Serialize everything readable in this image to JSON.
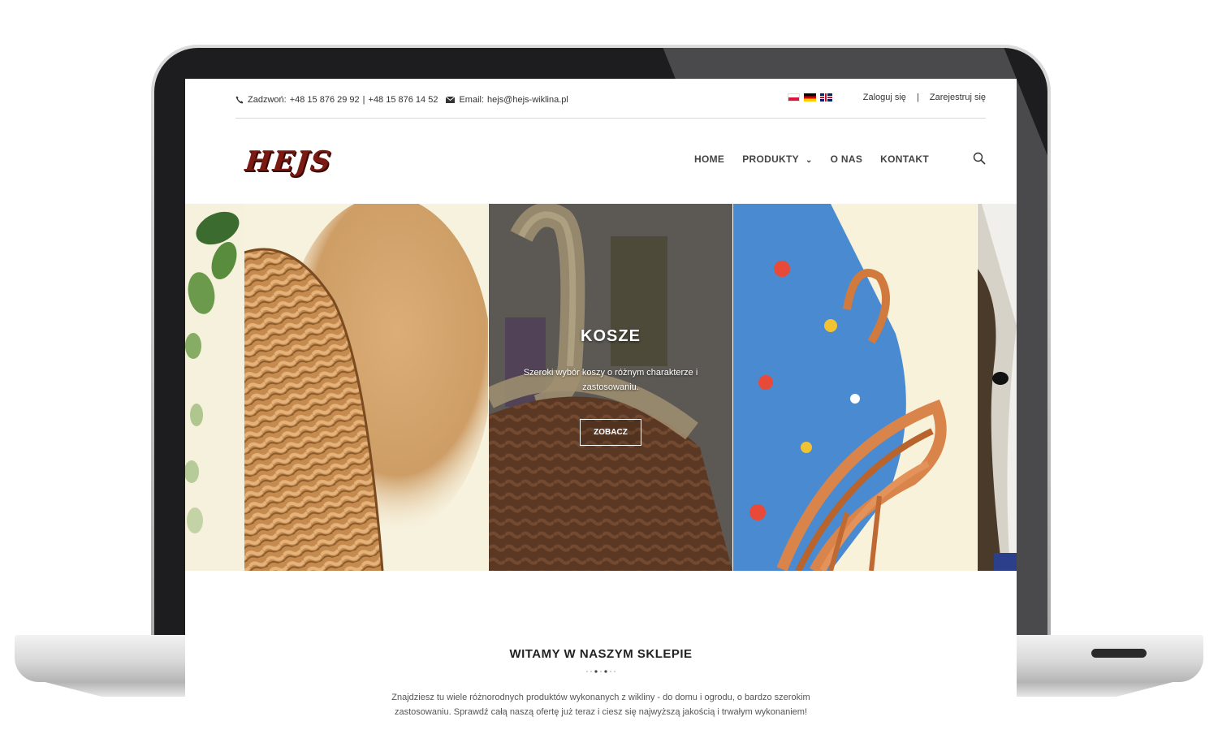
{
  "topbar": {
    "call_label": "Zadzwoń:",
    "phone1": "+48 15 876 29 92",
    "phone_sep": "|",
    "phone2": "+48 15 876 14 52",
    "email_label": "Email:",
    "email": "hejs@hejs-wiklina.pl",
    "login": "Zaloguj się",
    "account_sep": "|",
    "register": "Zarejestruj się",
    "flags": [
      "pl-flag-icon",
      "de-flag-icon",
      "en-flag-icon"
    ]
  },
  "header": {
    "logo": "HEJS",
    "nav": {
      "home": "HOME",
      "products": "PRODUKTY",
      "about": "O NAS",
      "contact": "KONTAKT"
    }
  },
  "slider": {
    "active": {
      "title": "KOSZE",
      "description": "Szeroki wybór koszy o różnym charakterze i zastosowaniu.",
      "button": "ZOBACZ"
    }
  },
  "welcome": {
    "title": "WITAMY W NASZYM SKLEPIE",
    "text": "Znajdziesz tu wiele różnorodnych produktów wykonanych z wikliny - do domu i ogrodu, o bardzo szerokim zastosowaniu. Sprawdź całą naszą ofertę już teraz i ciesz się najwyższą jakością i trwałym wykonaniem!"
  },
  "colors": {
    "logo": "#7a1a12",
    "wicker": "#c48a4e",
    "bezel": "#1d1d1f"
  }
}
